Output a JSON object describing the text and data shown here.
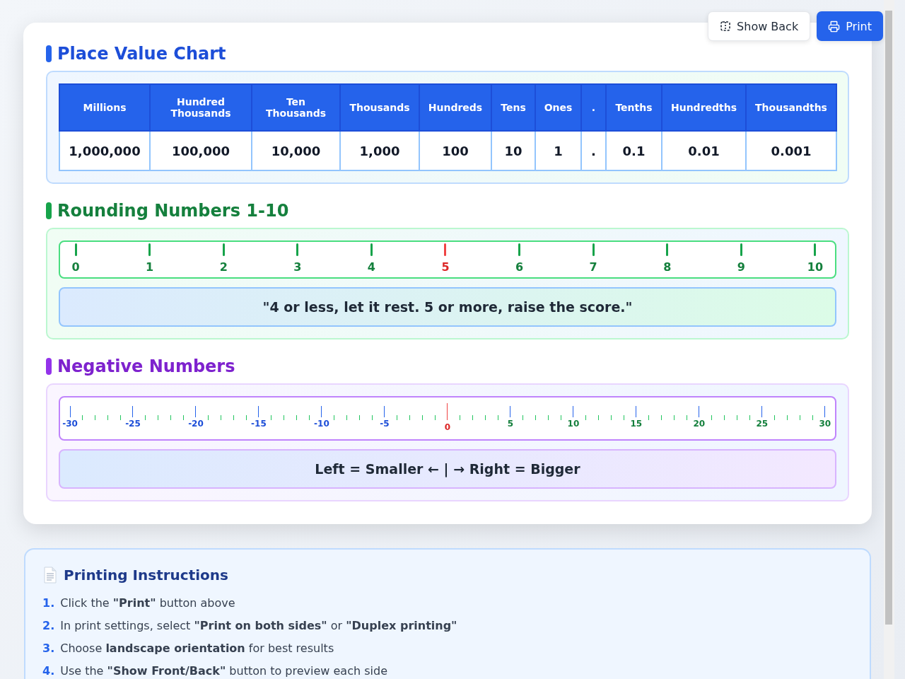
{
  "toolbar": {
    "buttons": [
      {
        "label": "Show Back",
        "kind": "secondary"
      },
      {
        "label": "Print",
        "kind": "primary"
      }
    ]
  },
  "place_value": {
    "title": "Place Value Chart",
    "columns": [
      {
        "label": "Millions",
        "value": "1,000,000"
      },
      {
        "label": "Hundred Thousands",
        "value": "100,000"
      },
      {
        "label": "Ten Thousands",
        "value": "10,000"
      },
      {
        "label": "Thousands",
        "value": "1,000"
      },
      {
        "label": "Hundreds",
        "value": "100"
      },
      {
        "label": "Tens",
        "value": "10"
      },
      {
        "label": "Ones",
        "value": "1"
      },
      {
        "label": ".",
        "value": "."
      },
      {
        "label": "Tenths",
        "value": "0.1"
      },
      {
        "label": "Hundredths",
        "value": "0.01"
      },
      {
        "label": "Thousandths",
        "value": "0.001"
      }
    ]
  },
  "rounding": {
    "title": "Rounding Numbers 1-10",
    "marks": [
      {
        "label": "0",
        "highlighted": false
      },
      {
        "label": "1",
        "highlighted": false
      },
      {
        "label": "2",
        "highlighted": false
      },
      {
        "label": "3",
        "highlighted": false
      },
      {
        "label": "4",
        "highlighted": false
      },
      {
        "label": "5",
        "highlighted": true
      },
      {
        "label": "6",
        "highlighted": false
      },
      {
        "label": "7",
        "highlighted": false
      },
      {
        "label": "8",
        "highlighted": false
      },
      {
        "label": "9",
        "highlighted": false
      },
      {
        "label": "10",
        "highlighted": false
      }
    ],
    "rhyme": "\"4 or less, let it rest. 5 or more, raise the score.\""
  },
  "negative": {
    "title": "Negative Numbers",
    "labels": [
      {
        "label": "-30",
        "kind": "negative"
      },
      {
        "label": "-25",
        "kind": "negative"
      },
      {
        "label": "-20",
        "kind": "negative"
      },
      {
        "label": "-15",
        "kind": "negative"
      },
      {
        "label": "-10",
        "kind": "negative"
      },
      {
        "label": "-5",
        "kind": "negative"
      },
      {
        "label": "0",
        "kind": "zero"
      },
      {
        "label": "5",
        "kind": "positive"
      },
      {
        "label": "10",
        "kind": "positive"
      },
      {
        "label": "15",
        "kind": "positive"
      },
      {
        "label": "20",
        "kind": "positive"
      },
      {
        "label": "25",
        "kind": "positive"
      },
      {
        "label": "30",
        "kind": "positive"
      }
    ],
    "hint": "Left = Smaller ← | → Right = Bigger"
  },
  "instructions": {
    "title": "Printing Instructions",
    "steps": [
      {
        "number": "1.",
        "text": "Click the **\"Print\"** button above"
      },
      {
        "number": "2.",
        "text": "In print settings, select **\"Print on both sides\"** or **\"Duplex printing\"**"
      },
      {
        "number": "3.",
        "text": "Choose **landscape orientation** for best results"
      },
      {
        "number": "4.",
        "text": "Use the **\"Show Front/Back\"** button to preview each side"
      }
    ]
  }
}
